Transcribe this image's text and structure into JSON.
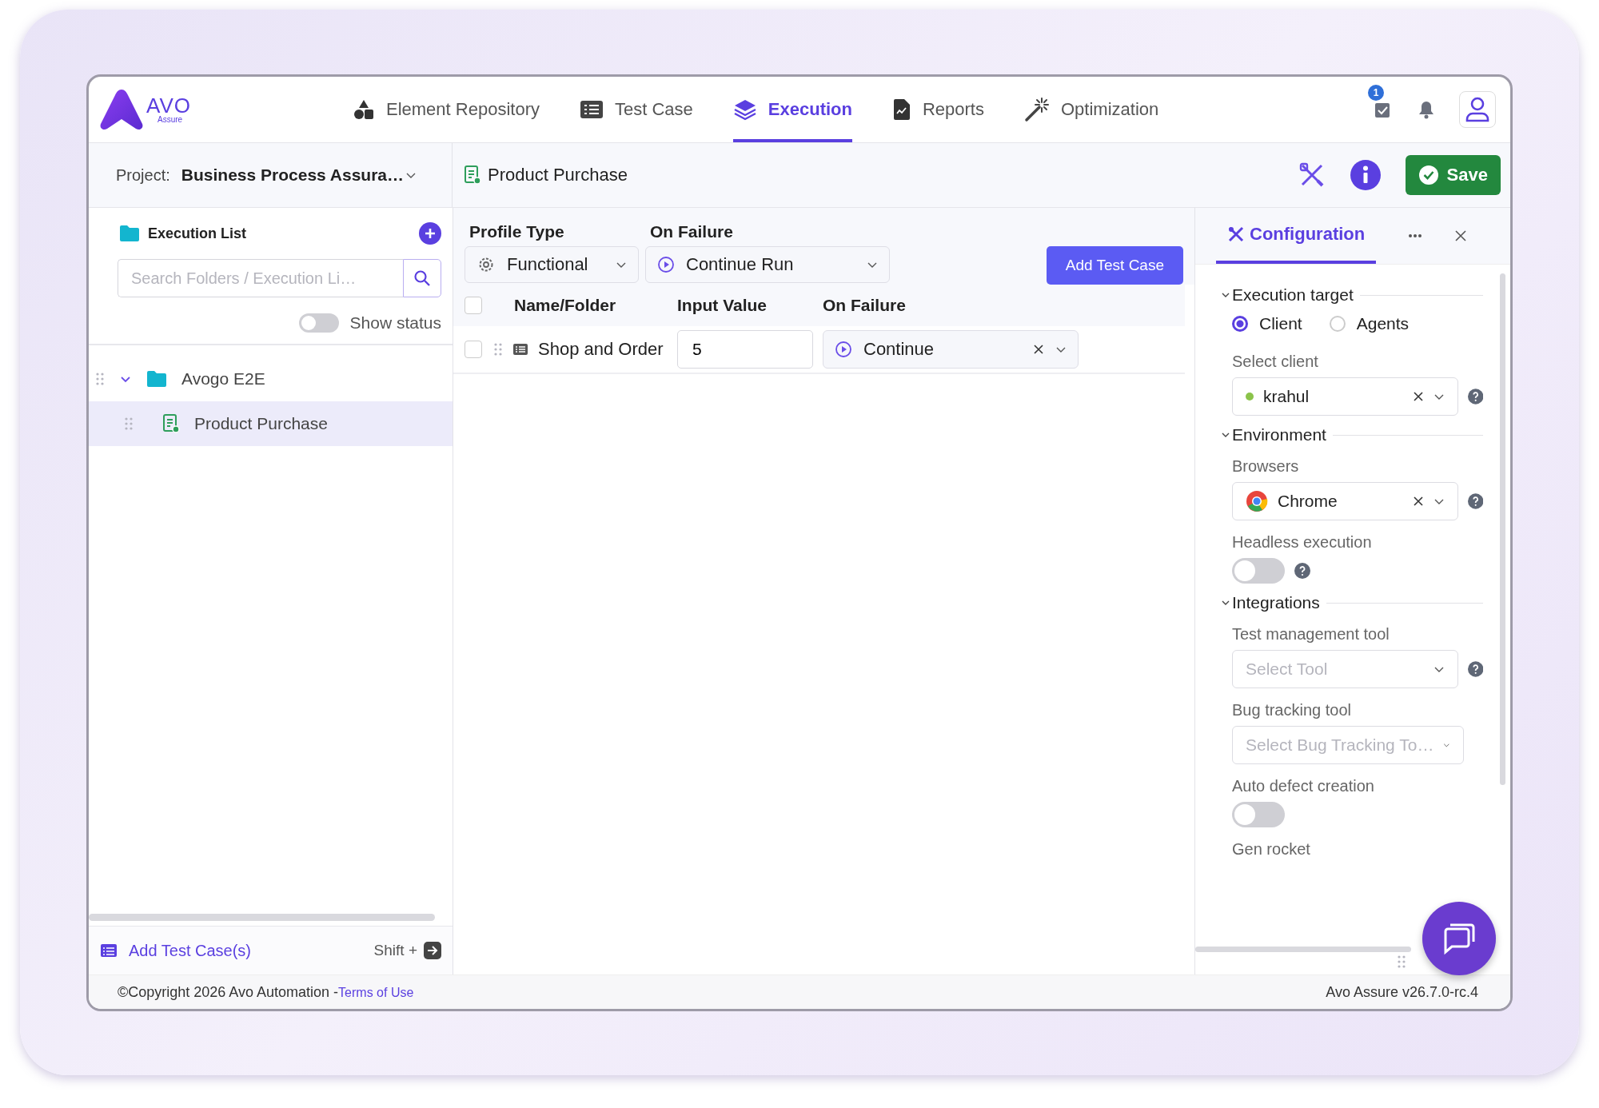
{
  "brand": {
    "name": "AVO",
    "tagline": "Assure"
  },
  "nav": [
    {
      "label": "Element Repository",
      "selected": false
    },
    {
      "label": "Test Case",
      "selected": false
    },
    {
      "label": "Execution",
      "selected": true
    },
    {
      "label": "Reports",
      "selected": false
    },
    {
      "label": "Optimization",
      "selected": false
    }
  ],
  "notifications": {
    "count": "1"
  },
  "project": {
    "label": "Project:",
    "value": "Business Process Assura…"
  },
  "breadcrumb": "Product Purchase",
  "save_button": "Save",
  "sidebar": {
    "title": "Execution List",
    "search": {
      "placeholder": "Search Folders / Execution Li…"
    },
    "show_status": {
      "label": "Show status",
      "on": false
    },
    "tree": [
      {
        "label": "Avogo E2E",
        "expanded": true,
        "selected": false,
        "children": [
          {
            "label": "Product Purchase",
            "selected": true
          }
        ]
      }
    ],
    "add_link": "Add Test Case(s)",
    "shortcut": "Shift +"
  },
  "toolbar": {
    "profile_type": {
      "label": "Profile Type",
      "value": "Functional"
    },
    "on_failure": {
      "label": "On Failure",
      "value": "Continue Run"
    },
    "add_button": "Add Test Case"
  },
  "table": {
    "all_checked": false,
    "columns": [
      "Name/Folder",
      "Input Value",
      "On Failure"
    ],
    "rows": [
      {
        "checked": false,
        "name": "Shop and Order",
        "input_value": "5",
        "on_failure": "Continue"
      }
    ]
  },
  "config": {
    "tab": "Configuration",
    "sections": [
      {
        "title": "Execution target",
        "expanded": true,
        "fields": [
          {
            "kind": "radio",
            "options": [
              {
                "label": "Client",
                "selected": true
              },
              {
                "label": "Agents",
                "selected": false
              }
            ]
          },
          {
            "kind": "select",
            "label": "Select client",
            "value": "krahul",
            "color": "#8bc34a",
            "help": true
          }
        ]
      },
      {
        "title": "Environment",
        "expanded": true,
        "fields": [
          {
            "kind": "browser",
            "label": "Browsers",
            "value": "Chrome",
            "help": true
          },
          {
            "kind": "toggle",
            "label": "Headless execution",
            "on": false,
            "help": true
          }
        ]
      },
      {
        "title": "Integrations",
        "expanded": true,
        "fields": [
          {
            "kind": "select",
            "label": "Test management tool",
            "placeholder": "Select Tool",
            "help": true
          },
          {
            "kind": "select",
            "label": "Bug tracking tool",
            "placeholder": "Select Bug Tracking To…"
          },
          {
            "kind": "toggle",
            "label": "Auto defect creation",
            "on": false
          },
          {
            "kind": "label",
            "label": "Gen rocket"
          }
        ]
      }
    ]
  },
  "footer": {
    "copyright": "©Copyright 2026 Avo Automation -",
    "link": "Terms of Use",
    "version": "Avo Assure v26.7.0-rc.4"
  }
}
